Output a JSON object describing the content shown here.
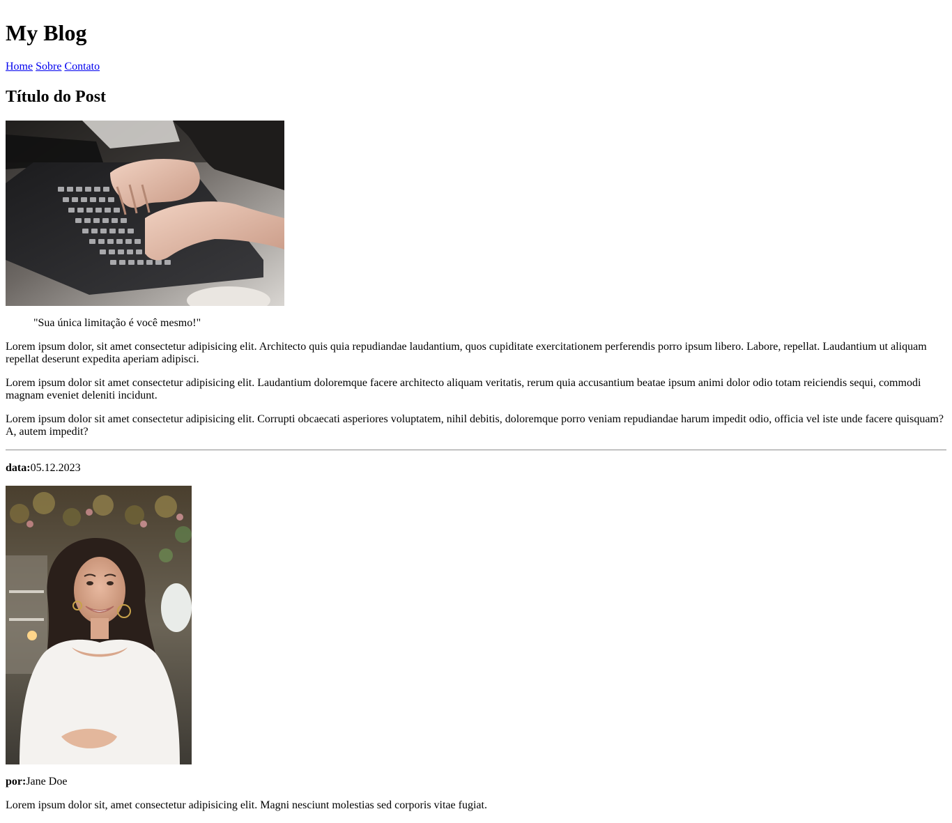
{
  "header": {
    "title": "My Blog",
    "nav": [
      "Home",
      "Sobre",
      "Contato"
    ]
  },
  "post": {
    "title": "Título do Post",
    "image_icon": "laptop-typing-photo",
    "quote": "\"Sua única limitação é você mesmo!\"",
    "paragraphs": [
      "Lorem ipsum dolor, sit amet consectetur adipisicing elit. Architecto quis quia repudiandae laudantium, quos cupiditate exercitationem perferendis porro ipsum libero. Labore, repellat. Laudantium ut aliquam repellat deserunt expedita aperiam adipisci.",
      "Lorem ipsum dolor sit amet consectetur adipisicing elit. Laudantium doloremque facere architecto aliquam veritatis, rerum quia accusantium beatae ipsum animi dolor odio totam reiciendis sequi, commodi magnam eveniet deleniti incidunt.",
      "Lorem ipsum dolor sit amet consectetur adipisicing elit. Corrupti obcaecati asperiores voluptatem, nihil debitis, doloremque porro veniam repudiandae harum impedit odio, officia vel iste unde facere quisquam? A, autem impedit?"
    ]
  },
  "meta": {
    "date_label": "data:",
    "date_value": "05.12.2023",
    "author_image_icon": "author-portrait-photo",
    "author_label": "por:",
    "author_value": "Jane Doe",
    "bio": "Lorem ipsum dolor sit, amet consectetur adipisicing elit. Magni nesciunt molestias sed corporis vitae fugiat."
  }
}
